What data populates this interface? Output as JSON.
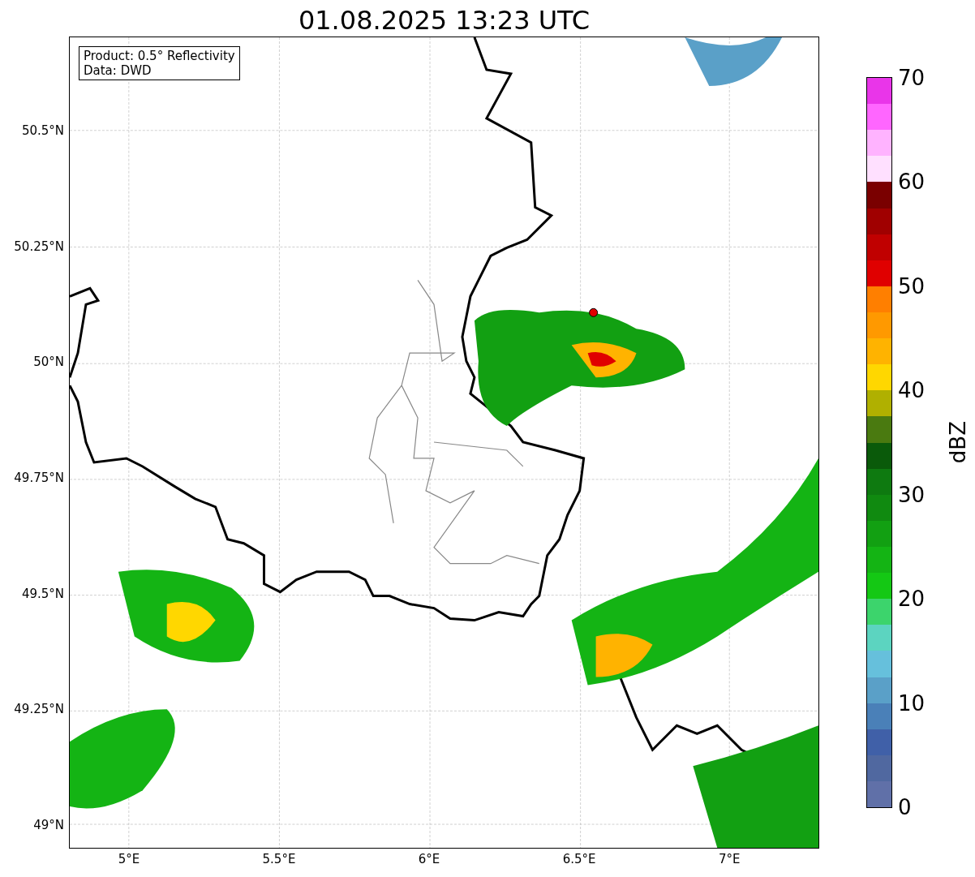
{
  "title": "01.08.2025 13:23 UTC",
  "legend": [
    "Product: 0.5° Reflectivity",
    "Data: DWD"
  ],
  "x_axis": {
    "ticks": [
      "5°E",
      "5.5°E",
      "6°E",
      "6.5°E",
      "7°E"
    ]
  },
  "y_axis": {
    "ticks": [
      "50.5°N",
      "50.25°N",
      "50°N",
      "49.75°N",
      "49.5°N",
      "49.25°N",
      "49°N"
    ]
  },
  "colorbar": {
    "label": "dBZ",
    "ticks": [
      "70",
      "60",
      "50",
      "40",
      "30",
      "20",
      "10",
      "0"
    ],
    "segments": [
      {
        "color": "#e935e9"
      },
      {
        "color": "#ff66ff"
      },
      {
        "color": "#ffb3ff"
      },
      {
        "color": "#ffe0ff"
      },
      {
        "color": "#7a0000"
      },
      {
        "color": "#a00000"
      },
      {
        "color": "#c00000"
      },
      {
        "color": "#e00000"
      },
      {
        "color": "#ff7f00"
      },
      {
        "color": "#ff9900"
      },
      {
        "color": "#ffb300"
      },
      {
        "color": "#ffd700"
      },
      {
        "color": "#b0b000"
      },
      {
        "color": "#4a7a10"
      },
      {
        "color": "#0a5a0a"
      },
      {
        "color": "#0e7a10"
      },
      {
        "color": "#108a10"
      },
      {
        "color": "#12a012"
      },
      {
        "color": "#14b414"
      },
      {
        "color": "#14c814"
      },
      {
        "color": "#3cd46c"
      },
      {
        "color": "#5cd4c0"
      },
      {
        "color": "#66c0dc"
      },
      {
        "color": "#5aa0c8"
      },
      {
        "color": "#4a80b8"
      },
      {
        "color": "#4060a8"
      },
      {
        "color": "#5068a0"
      },
      {
        "color": "#6070a8"
      }
    ]
  }
}
